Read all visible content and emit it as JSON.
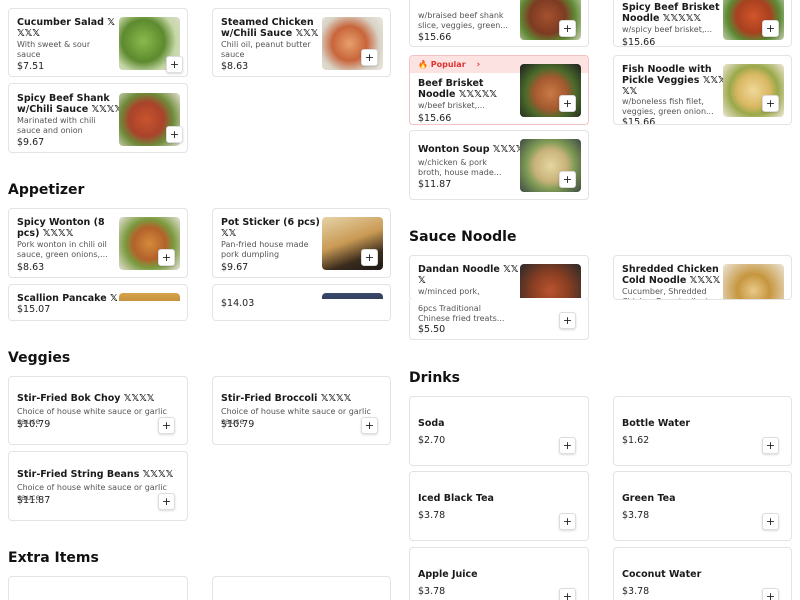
{
  "sections": {
    "appetizer": "Appetizer",
    "veggies": "Veggies",
    "extra_items": "Extra Items",
    "sauce_noodle": "Sauce Noodle",
    "drinks": "Drinks"
  },
  "popular_label": "Popular",
  "add_label": "+",
  "items": {
    "cucumber": {
      "name": "Cucumber Salad 𝕏\n𝕏𝕏𝕏",
      "desc": "With sweet & sour\nsauce",
      "price": "$7.51"
    },
    "steamed_chicken": {
      "name": "Steamed Chicken\nw/Chili Sauce 𝕏𝕏𝕏",
      "desc": "Chili oil, peanut butter\nsauce",
      "price": "$8.63"
    },
    "beef_shank_slices": {
      "name": "",
      "desc": "w/braised beef shank\nslice, veggies, green...",
      "price": "$15.66"
    },
    "spicy_beef_brisket": {
      "name": "Spicy Beef Brisket\nNoodle 𝕏𝕏𝕏𝕏𝕏",
      "desc": "w/spicy beef brisket,...",
      "price": "$15.66"
    },
    "spicy_beef_shank": {
      "name": "Spicy Beef Shank\nw/Chili Sauce 𝕏𝕏𝕏𝕏",
      "desc": "Marinated with chili\nsauce and onion",
      "price": "$9.67"
    },
    "beef_brisket": {
      "name": "Beef Brisket\nNoodle 𝕏𝕏𝕏𝕏𝕏",
      "desc": "w/beef brisket,...",
      "price": "$15.66"
    },
    "fish_noodle": {
      "name": "Fish Noodle with\nPickle Veggies 𝕏𝕏𝕏\n𝕏𝕏",
      "desc": "w/boneless fish filet,\nveggies, green onion...",
      "price": "$15.66"
    },
    "wonton_soup": {
      "name": "Wonton Soup 𝕏𝕏𝕏𝕏",
      "desc": "w/chicken & pork\nbroth, house made...",
      "price": "$11.87"
    },
    "spicy_wonton": {
      "name": "Spicy Wonton (8\npcs) 𝕏𝕏𝕏𝕏",
      "desc": "Pork wonton in chili oil\nsauce, green onions,...",
      "price": "$8.63"
    },
    "pot_sticker": {
      "name": "Pot Sticker (6 pcs)\n𝕏𝕏",
      "desc": "Pan-fried house made\npork dumpling",
      "price": "$9.67"
    },
    "scallion_pancake": {
      "name": "Scallion Pancake 𝕏",
      "desc": "",
      "price": "$15.07"
    },
    "hidden_item": {
      "name": "",
      "desc": "",
      "price": "$14.03"
    },
    "dandan": {
      "name": "Dandan Noodle 𝕏𝕏\n𝕏",
      "desc": "w/minced pork,\ncucumber, crushed",
      "price": ""
    },
    "shredded_chicken": {
      "name": "Shredded Chicken\nCold Noodle 𝕏𝕏𝕏𝕏",
      "desc": "Cucumber, Shredded\nChicken Breast, silent...",
      "price": ""
    },
    "trad_fried": {
      "name": "",
      "desc": "6pcs Traditional\nChinese fried treats...",
      "price": "$5.50"
    },
    "bok_choy": {
      "name": "Stir-Fried Bok Choy 𝕏𝕏𝕏𝕏",
      "desc": "Choice of house white sauce or garlic sauce",
      "price": "$10.79"
    },
    "broccoli": {
      "name": "Stir-Fried Broccoli 𝕏𝕏𝕏𝕏",
      "desc": "Choice of house white sauce or garlic sauce",
      "price": "$10.79"
    },
    "string_beans": {
      "name": "Stir-Fried String Beans 𝕏𝕏𝕏𝕏",
      "desc": "Choice of house white sauce or garlic sauce",
      "price": "$11.87"
    },
    "soda": {
      "name": "Soda",
      "price": "$2.70"
    },
    "bottle_water": {
      "name": "Bottle Water",
      "price": "$1.62"
    },
    "iced_black_tea": {
      "name": "Iced Black Tea",
      "price": "$3.78"
    },
    "green_tea": {
      "name": "Green Tea",
      "price": "$3.78"
    },
    "apple_juice": {
      "name": "Apple Juice",
      "price": "$3.78"
    },
    "coconut_water": {
      "name": "Coconut Water",
      "price": "$3.78"
    }
  },
  "colors": {
    "popular_bg": "#fde2e2",
    "popular_text": "#d33333",
    "card_border": "#e3e3e3"
  }
}
